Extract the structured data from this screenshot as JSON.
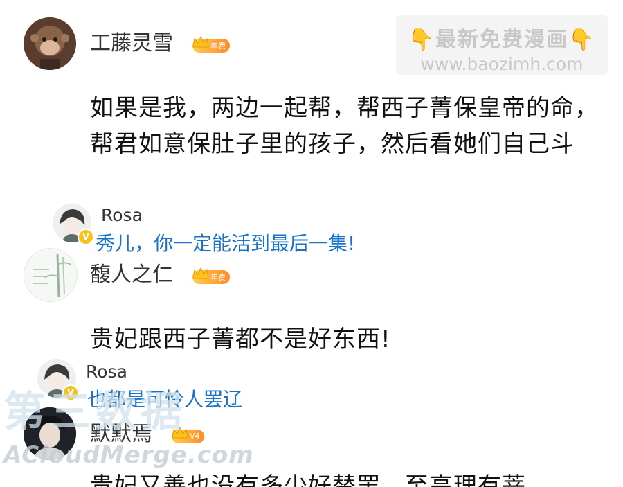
{
  "watermark_top": {
    "line1": "👇最新免费漫画👇",
    "line2": "www.baozimh.com"
  },
  "watermark_bottom": {
    "big": "第三数据",
    "site": "ACloudMerge.com"
  },
  "comments": [
    {
      "user": "工藤灵雪",
      "badge": "年费",
      "text": "如果是我，两边一起帮，帮西子菁保皇帝的命，帮君如意保肚子里的孩子，然后看她们自己斗",
      "reply": {
        "user": "Rosa",
        "text": "秀儿，你一定能活到最后一集!"
      }
    },
    {
      "user": "馥人之仁",
      "badge": "年费",
      "text": "贵妃跟西子菁都不是好东西!",
      "reply": {
        "user": "Rosa",
        "text": "也都是可怜人罢辽"
      }
    },
    {
      "user": "默默焉",
      "badge": "V4",
      "text": "贵妃又善也没有多少好替罢，至高理有菩"
    }
  ],
  "colors": {
    "reply_text": "#1a73c8",
    "badge": "#ff9a2e"
  },
  "icons": {
    "badge": "crown-icon",
    "verified": "verified-v-icon"
  }
}
